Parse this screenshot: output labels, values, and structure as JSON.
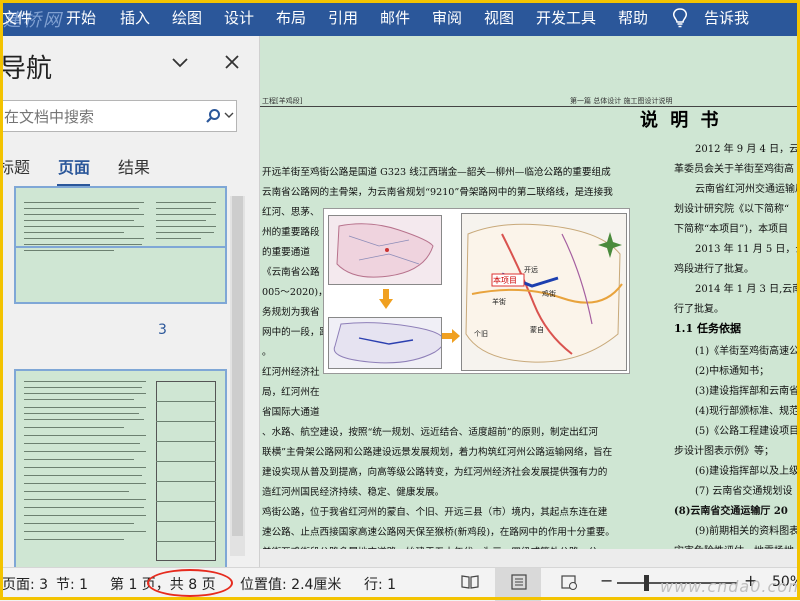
{
  "menu": {
    "watermark": "建桥网",
    "items": [
      "文件",
      "开始",
      "插入",
      "绘图",
      "设计",
      "布局",
      "引用",
      "邮件",
      "审阅",
      "视图",
      "开发工具",
      "帮助",
      "告诉我"
    ]
  },
  "nav": {
    "title": "导航",
    "search_placeholder": "在文档中搜索",
    "tabs": [
      "标题",
      "页面",
      "结果"
    ],
    "active_tab": "页面",
    "thumb_page_label": "3"
  },
  "doc": {
    "header_left": "工程[羊鸡段]",
    "header_right": "第一篇  总体设计    施工图设计说明",
    "title": "说 明 书",
    "left_lines": [
      "开远羊街至鸡街公路是国道 G323 线江西瑞金—韶关—柳州—临沧公路的重要组成",
      "云南省公路网的主骨架，为云南省规划“9210”骨架路网中的第二联络线，是连接我",
      "红河、思茅、",
      "州的重要路段",
      "的重要通道",
      "《云南省公路",
      "005～2020)，",
      "务规划为我省",
      "网中的一段，路",
      "。",
      "红河州经济社",
      "局，红河州在",
      "省国际大通道",
      "、水路、航空建设，按照“统一规划、远近结合、适度超前”的原则，制定出红河",
      "联横”主骨架公路网和公路建设远景发展规划，着力构筑红河州公路运输网络，旨在",
      "建设实现从普及到提高，向高等级公路转变，为红河州经济社会发展提供强有力的",
      "造红河州国民经济持续、稳定、健康发展。",
      "鸡街公路，位于我省红河州的蒙自、个旧、开远三县（市）境内，其起点东连在建",
      "速公路、止点西接国家高速公路网天保至猴桥(新鸡段)，在路网中的作用十分重要。",
      "羊街至鸡街段公路多属地方道路，始建于五十年代，为三、四级或等外公路，公"
    ],
    "right_lines": [
      "2012 年 9 月 4 日，云南",
      "革委员会关于羊街至鸡街高",
      "云南省红河州交通运输局",
      "划设计研究院《以下简称“",
      "下简称“本项目”)，本项目",
      "2013 年 11 月 5 日，云",
      "鸡段进行了批复。",
      "2014 年 1 月 3 日,云南",
      "行了批复。"
    ],
    "section_heading": "1.1  任务依据",
    "basis_items": [
      "(1)《羊街至鸡街高速公",
      "(2)中标通知书；",
      "(3)建设指挥部和云南省",
      "(4)现行部颁标准、规范",
      "(5)《公路工程建设项目",
      "步设计图表示例》等；",
      "(6)建设指挥部以及上级",
      "(7)  云南省交通规划设",
      "(8)云南省交通运输厅 20",
      "(9)前期相关的资料图表",
      "灾害危险性评估、地震场地"
    ],
    "figure_labels": {
      "project": "本项目",
      "kaiyuan": "开远",
      "gejiu": "个旧",
      "mengzi": "蒙自",
      "jijie": "鸡街",
      "yangjie": "羊街"
    }
  },
  "status": {
    "page": "页面: 3",
    "section": "节: 1",
    "page_of": "第 1 页，共 8 页",
    "position": "位置值: 2.4厘米",
    "line": "行: 1",
    "zoom": "50%",
    "watermark": "www.cnda0.com"
  }
}
